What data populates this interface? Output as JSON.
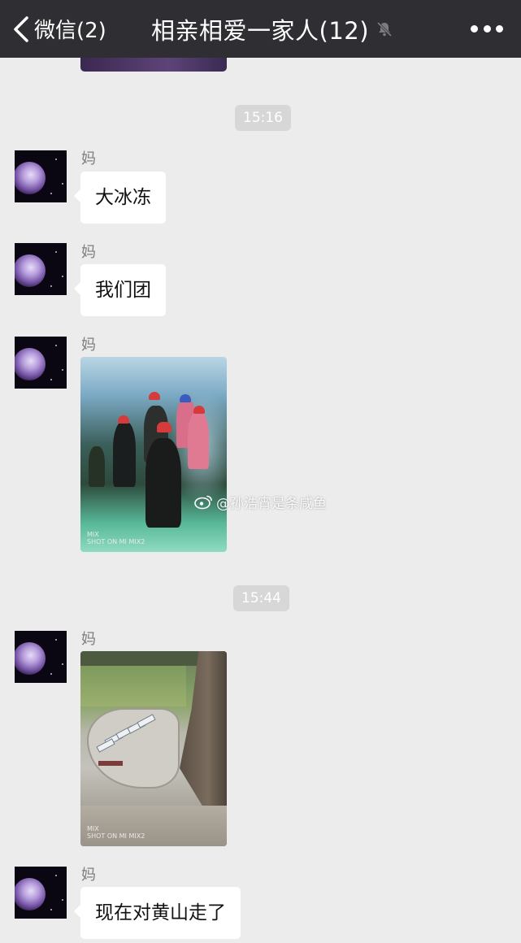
{
  "header": {
    "back_label": "微信(2)",
    "title": "相亲相爱一家人(12)",
    "icons": {
      "back": "chevron-left-icon",
      "mute": "bell-off-icon",
      "more": "more-dots-icon"
    }
  },
  "timestamps": [
    "15:16",
    "15:44"
  ],
  "messages": [
    {
      "sender": "妈",
      "type": "text",
      "text": "大冰冻"
    },
    {
      "sender": "妈",
      "type": "text",
      "text": "我们团"
    },
    {
      "sender": "妈",
      "type": "image",
      "subject": "ice-cave-photo",
      "corner_text": "MIX\nSHOT ON MI MIX2"
    },
    {
      "sender": "妈",
      "type": "image",
      "subject": "valley-parking-photo",
      "corner_text": "MIX\nSHOT ON MI MIX2"
    },
    {
      "sender": "妈",
      "type": "text",
      "text": "现在对黄山走了"
    }
  ],
  "watermark": {
    "text": "@孙浩宵是条咸鱼",
    "icon": "weibo-icon"
  },
  "colors": {
    "header_bg": "#2e2e33",
    "chat_bg": "#ececec",
    "bubble": "#ffffff",
    "timestamp_bg": "#d7d7d7"
  }
}
